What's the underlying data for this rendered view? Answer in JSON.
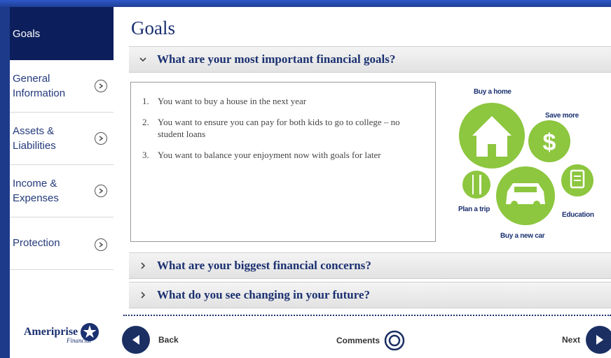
{
  "sidebar": {
    "active": "Goals",
    "items": [
      {
        "label_1": "General",
        "label_2": "Information"
      },
      {
        "label_1": "Assets &",
        "label_2": "Liabilities"
      },
      {
        "label_1": "Income &",
        "label_2": "Expenses"
      },
      {
        "label_1": "Protection",
        "label_2": ""
      }
    ],
    "logo": {
      "word": "Ameriprise",
      "sub": "Financial"
    }
  },
  "main": {
    "title": "Goals",
    "sections": [
      {
        "question": "What are your most important financial goals?",
        "expanded": true
      },
      {
        "question": "What are your biggest financial concerns?",
        "expanded": false
      },
      {
        "question": "What do you see changing in your future?",
        "expanded": false
      }
    ],
    "goals": [
      {
        "num": "1.",
        "text": "You want to buy a house in the next year"
      },
      {
        "num": "2.",
        "text": "You want to ensure you can pay for both kids to go to college – no student loans"
      },
      {
        "num": "3.",
        "text": "You want to balance your enjoyment now with goals for later"
      }
    ],
    "illustration": {
      "labels": {
        "home": "Buy a home",
        "save": "Save more",
        "trip": "Plan a trip",
        "education": "Education",
        "car": "Buy a new car"
      },
      "colors": {
        "green": "#8dc63f",
        "navy": "#1a3070"
      }
    }
  },
  "nav": {
    "back": "Back",
    "comments": "Comments",
    "next": "Next"
  }
}
